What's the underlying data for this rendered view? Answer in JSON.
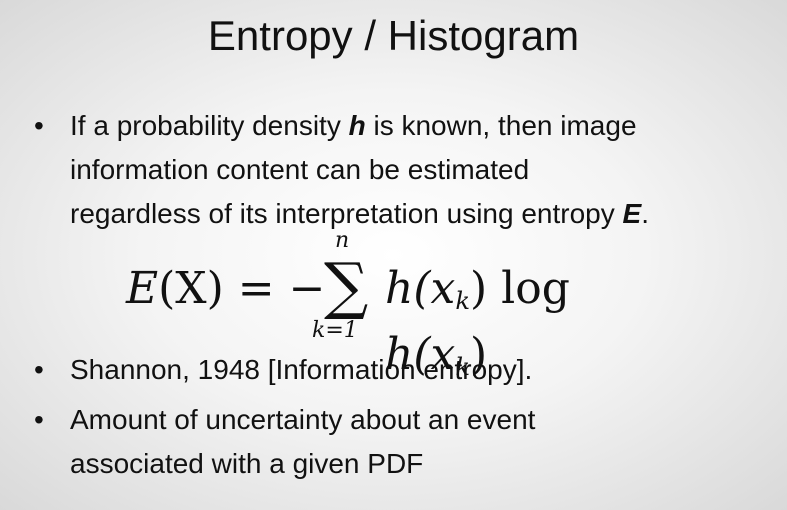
{
  "title": "Entropy / Histogram",
  "bullets": {
    "b1": {
      "dot": "•",
      "l1_a": "If a probability density ",
      "l1_h": "h",
      "l1_b": " is known, then image",
      "l2": "information content can be estimated",
      "l3_a": "regardless of its interpretation using entropy ",
      "l3_E": "E",
      "l3_b": "."
    },
    "b2": {
      "dot": "•",
      "text": "Shannon, 1948 [Information entropy]."
    },
    "b3": {
      "dot": "•",
      "l1": "Amount of uncertainty about an event",
      "l2": "associated with a given PDF"
    }
  },
  "formula": {
    "lhs_E": "E",
    "lhs_rest": "(X) = −",
    "sum_symbol": "∑",
    "upper": "n",
    "lower": "k=1",
    "rhs_h1": "h",
    "rhs_x1": "(x",
    "rhs_k1": "k",
    "rhs_log": ") log ",
    "rhs_h2": "h",
    "rhs_x2": "(x",
    "rhs_k2": "k",
    "rhs_end": ")"
  }
}
